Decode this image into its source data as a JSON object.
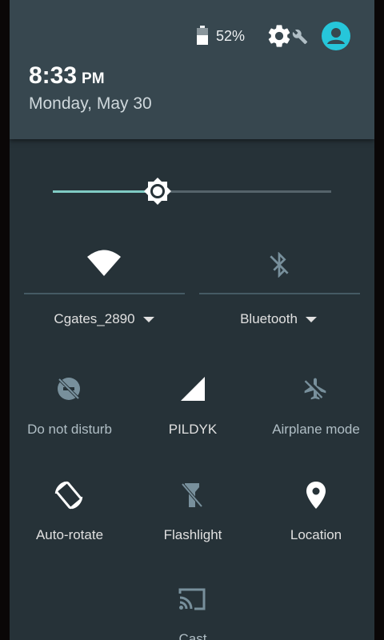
{
  "status": {
    "battery_percent": "52%",
    "battery_level": 0.52
  },
  "clock": {
    "time": "8:33",
    "ampm": "PM",
    "date": "Monday, May 30"
  },
  "brightness": {
    "level": 0.38
  },
  "tiles": {
    "wifi": {
      "label": "Cgates_2890",
      "icon": "wifi-icon",
      "state": "on"
    },
    "bluetooth": {
      "label": "Bluetooth",
      "icon": "bluetooth-disabled-icon",
      "state": "off"
    },
    "dnd": {
      "label": "Do not disturb",
      "icon": "do-not-disturb-off-icon",
      "state": "off"
    },
    "cellular": {
      "label": "PILDYK",
      "icon": "signal-icon",
      "state": "on"
    },
    "airplane": {
      "label": "Airplane mode",
      "icon": "airplane-off-icon",
      "state": "off"
    },
    "rotate": {
      "label": "Auto-rotate",
      "icon": "rotate-icon",
      "state": "on"
    },
    "flashlight": {
      "label": "Flashlight",
      "icon": "flashlight-off-icon",
      "state": "off"
    },
    "location": {
      "label": "Location",
      "icon": "location-pin-icon",
      "state": "on"
    },
    "cast": {
      "label": "Cast",
      "icon": "cast-icon",
      "state": "off"
    }
  },
  "colors": {
    "panel": "#263238",
    "header": "#37474f",
    "accent": "#80cbc4",
    "avatar": "#26c6da"
  }
}
